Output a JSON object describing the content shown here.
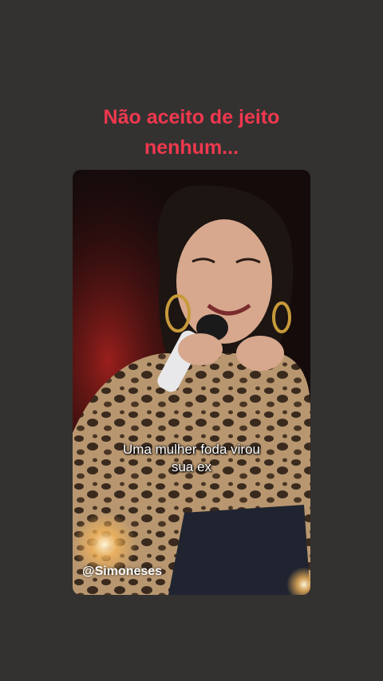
{
  "story": {
    "headline_line1": "Não aceito de jeito",
    "headline_line2": "nenhum...",
    "headline_color": "#f0384e",
    "background_color": "#333231"
  },
  "video": {
    "subtitle_line1": "Uma mulher foda virou",
    "subtitle_line2": "sua ex",
    "handle": "@Simoneses"
  }
}
